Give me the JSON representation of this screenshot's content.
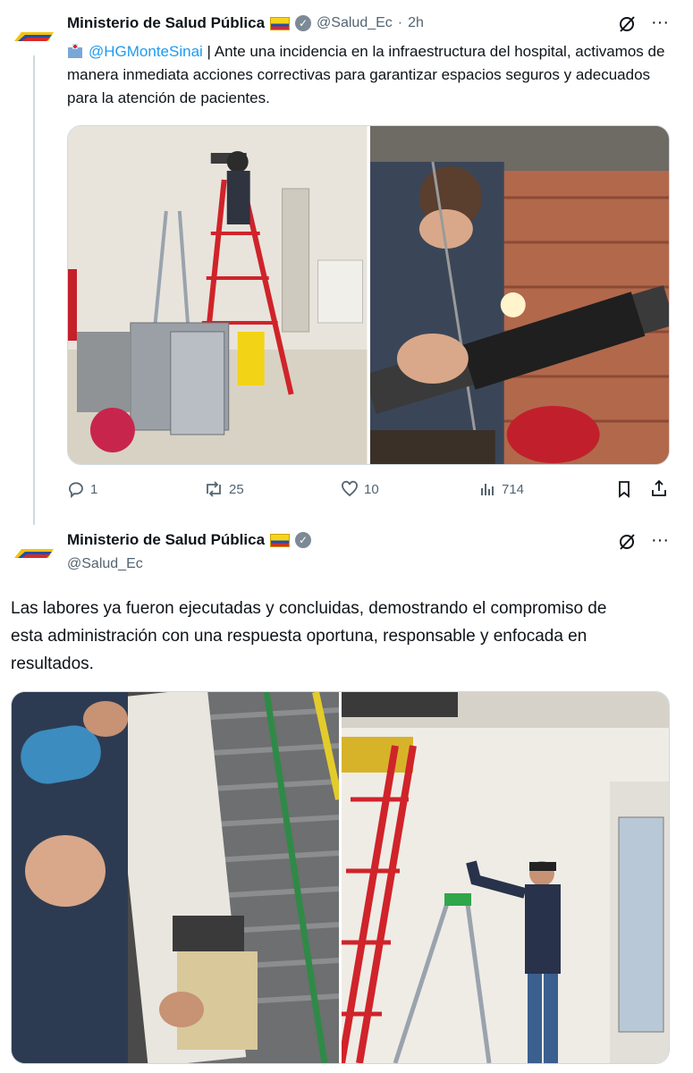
{
  "tweet1": {
    "author_name": "Ministerio de Salud Pública",
    "handle": "@Salud_Ec",
    "separator": "·",
    "time": "2h",
    "mention": "@HGMonteSinai",
    "text": " | Ante una incidencia en la infraestructura del hospital, activamos de manera inmediata acciones correctivas para garantizar espacios seguros y adecuados para la atención de pacientes.",
    "replies": "1",
    "reposts": "25",
    "likes": "10",
    "views": "714"
  },
  "tweet2": {
    "author_name": "Ministerio de Salud Pública",
    "handle": "@Salud_Ec",
    "text": "Las labores ya fueron ejecutadas y concluidas, demostrando el compromiso de esta administración con una respuesta oportuna, responsable y enfocada en resultados."
  },
  "colors": {
    "accent": "#1d9bf0",
    "text": "#0f1419",
    "secondary": "#536471",
    "border": "#cfd9de",
    "ladder_red": "#d0232a"
  },
  "icons": [
    "grok-icon",
    "more-icon",
    "reply-icon",
    "repost-icon",
    "like-icon",
    "views-icon",
    "bookmark-icon",
    "share-icon",
    "verified-icon",
    "hospital-icon"
  ]
}
